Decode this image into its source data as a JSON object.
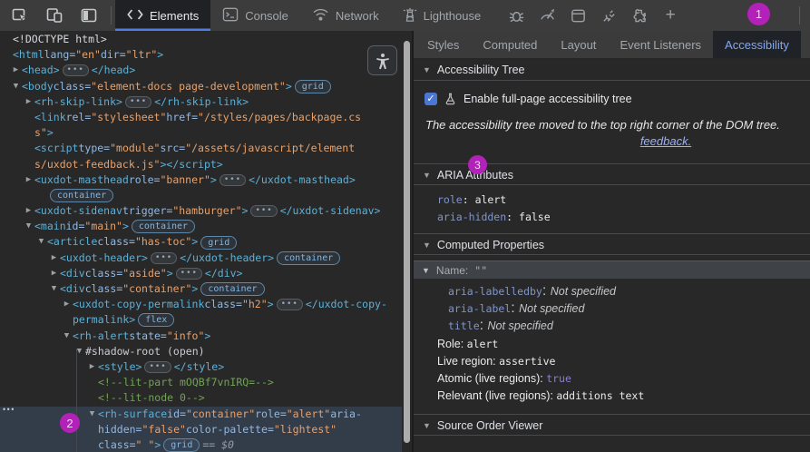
{
  "colors": {
    "accent_blue": "#4E7DE8",
    "badge_magenta": "#B322B8",
    "checkbox_blue": "#4A77D4",
    "link_blue": "#9BB0F5",
    "selection_bg": "#333C49"
  },
  "toolbar": {
    "left_icons": [
      "inspect-icon",
      "device-toolbar-icon",
      "dock-panel-icon"
    ],
    "tabs": [
      {
        "label": "Elements",
        "icon": "code-icon",
        "active": true
      },
      {
        "label": "Console",
        "icon": "console-icon",
        "active": false
      },
      {
        "label": "Network",
        "icon": "network-icon",
        "active": false
      },
      {
        "label": "Lighthouse",
        "icon": "lighthouse-icon",
        "active": false
      }
    ],
    "icon_tabs": [
      "bug-icon",
      "performance-gauge-icon",
      "application-box-icon",
      "plug-icon",
      "extension-puzzle-icon"
    ],
    "more_tabs_label": "+"
  },
  "annotations": {
    "step1": "1",
    "step2": "2",
    "step3": "3"
  },
  "dom_tree": {
    "gutter_dots": "•••",
    "accessibility_toggle_icon": "accessibility-person-icon",
    "rows": [
      {
        "d": 0,
        "seg": [
          [
            "p",
            "<!DOCTYPE html>"
          ]
        ]
      },
      {
        "d": 0,
        "seg": [
          [
            "t",
            "<html "
          ],
          [
            "a",
            "lang="
          ],
          [
            "v",
            "\"en\""
          ],
          [
            "a",
            " dir="
          ],
          [
            "v",
            "\"ltr\""
          ],
          [
            "t",
            ">"
          ]
        ]
      },
      {
        "d": 1,
        "a": "r",
        "seg": [
          [
            "t",
            "<head>"
          ],
          [
            "e",
            "…"
          ],
          [
            "t",
            "</head>"
          ]
        ]
      },
      {
        "d": 1,
        "a": "d",
        "seg": [
          [
            "t",
            "<body "
          ],
          [
            "a",
            "class="
          ],
          [
            "v",
            "\"element-docs page-development\""
          ],
          [
            "t",
            ">"
          ],
          [
            "b",
            "grid"
          ]
        ]
      },
      {
        "d": 2,
        "a": "r",
        "seg": [
          [
            "t",
            "<rh-skip-link>"
          ],
          [
            "e",
            "…"
          ],
          [
            "t",
            "</rh-skip-link>"
          ]
        ]
      },
      {
        "d": 2,
        "seg": [
          [
            "t",
            "<link "
          ],
          [
            "a",
            "rel="
          ],
          [
            "v",
            "\"stylesheet\""
          ],
          [
            "a",
            " href="
          ],
          [
            "v",
            "\"/styles/pages/backpage.cs"
          ]
        ]
      },
      {
        "d": 2,
        "seg": [
          [
            "v",
            "s\""
          ],
          [
            "t",
            ">"
          ]
        ]
      },
      {
        "d": 2,
        "seg": [
          [
            "t",
            "<script "
          ],
          [
            "a",
            "type="
          ],
          [
            "v",
            "\"module\""
          ],
          [
            "a",
            " src="
          ],
          [
            "v",
            "\"/assets/javascript/element"
          ]
        ]
      },
      {
        "d": 2,
        "seg": [
          [
            "v",
            "s/uxdot-feedback.js\""
          ],
          [
            "t",
            "></script>"
          ]
        ]
      },
      {
        "d": 2,
        "a": "r",
        "seg": [
          [
            "t",
            "<uxdot-masthead "
          ],
          [
            "a",
            "role="
          ],
          [
            "v",
            "\"banner\""
          ],
          [
            "t",
            ">"
          ],
          [
            "e",
            "…"
          ],
          [
            "t",
            "</uxdot-masthead>"
          ]
        ]
      },
      {
        "d": 3,
        "seg": [
          [
            "b",
            "container"
          ]
        ]
      },
      {
        "d": 2,
        "a": "r",
        "seg": [
          [
            "t",
            "<uxdot-sidenav "
          ],
          [
            "a",
            "trigger="
          ],
          [
            "v",
            "\"hamburger\""
          ],
          [
            "t",
            ">"
          ],
          [
            "e",
            "…"
          ],
          [
            "t",
            "</uxdot-sidenav>"
          ]
        ]
      },
      {
        "d": 2,
        "a": "d",
        "seg": [
          [
            "t",
            "<main "
          ],
          [
            "a",
            "id="
          ],
          [
            "v",
            "\"main\""
          ],
          [
            "t",
            ">"
          ],
          [
            "b",
            "container"
          ]
        ]
      },
      {
        "d": 3,
        "a": "d",
        "seg": [
          [
            "t",
            "<article "
          ],
          [
            "a",
            "class="
          ],
          [
            "v",
            "\"has-toc\""
          ],
          [
            "t",
            ">"
          ],
          [
            "b",
            "grid"
          ]
        ]
      },
      {
        "d": 4,
        "a": "r",
        "seg": [
          [
            "t",
            "<uxdot-header>"
          ],
          [
            "e",
            "…"
          ],
          [
            "t",
            "</uxdot-header>"
          ],
          [
            "b",
            "container"
          ]
        ]
      },
      {
        "d": 4,
        "a": "r",
        "seg": [
          [
            "t",
            "<div "
          ],
          [
            "a",
            "class="
          ],
          [
            "v",
            "\"aside\""
          ],
          [
            "t",
            ">"
          ],
          [
            "e",
            "…"
          ],
          [
            "t",
            "</div>"
          ]
        ]
      },
      {
        "d": 4,
        "a": "d",
        "seg": [
          [
            "t",
            "<div "
          ],
          [
            "a",
            "class="
          ],
          [
            "v",
            "\"container\""
          ],
          [
            "t",
            ">"
          ],
          [
            "b",
            "container"
          ]
        ]
      },
      {
        "d": 5,
        "a": "r",
        "seg": [
          [
            "t",
            "<uxdot-copy-permalink "
          ],
          [
            "a",
            "class="
          ],
          [
            "v",
            "\"h2\""
          ],
          [
            "t",
            ">"
          ],
          [
            "e",
            "…"
          ],
          [
            "t",
            "</uxdot-copy-"
          ]
        ]
      },
      {
        "d": 5,
        "seg": [
          [
            "t",
            "permalink>"
          ],
          [
            "b",
            "flex"
          ]
        ]
      },
      {
        "d": 5,
        "a": "d",
        "seg": [
          [
            "t",
            "<rh-alert "
          ],
          [
            "a",
            "state="
          ],
          [
            "v",
            "\"info\""
          ],
          [
            "t",
            ">"
          ]
        ]
      },
      {
        "d": 6,
        "a": "d",
        "seg": [
          [
            "s",
            "#shadow-root (open)"
          ]
        ]
      },
      {
        "d": 7,
        "a": "r",
        "seg": [
          [
            "t",
            "<style>"
          ],
          [
            "e",
            "…"
          ],
          [
            "t",
            "</style>"
          ]
        ]
      },
      {
        "d": 7,
        "seg": [
          [
            "c",
            "<!--lit-part mOQBf7vnIRQ=-->"
          ]
        ]
      },
      {
        "d": 7,
        "seg": [
          [
            "c",
            "<!--lit-node 0-->"
          ]
        ]
      },
      {
        "d": 7,
        "a": "d",
        "sel": true,
        "seg": [
          [
            "t",
            "<rh-surface "
          ],
          [
            "a",
            "id="
          ],
          [
            "v",
            "\"container\""
          ],
          [
            "a",
            " role="
          ],
          [
            "v",
            "\"alert\""
          ],
          [
            "a",
            " aria-"
          ]
        ]
      },
      {
        "d": 7,
        "sel": true,
        "seg": [
          [
            "a",
            "hidden="
          ],
          [
            "v",
            "\"false\""
          ],
          [
            "a",
            " color-palette="
          ],
          [
            "v",
            "\"lightest\""
          ]
        ]
      },
      {
        "d": 7,
        "sel": true,
        "seg": [
          [
            "a",
            "class="
          ],
          [
            "v",
            "\"  \""
          ],
          [
            "t",
            ">"
          ],
          [
            "b",
            "grid"
          ],
          [
            "d",
            " == $0"
          ]
        ]
      }
    ]
  },
  "sidebar": {
    "tabs": [
      {
        "label": "Styles",
        "active": false
      },
      {
        "label": "Computed",
        "active": false
      },
      {
        "label": "Layout",
        "active": false
      },
      {
        "label": "Event Listeners",
        "active": false
      },
      {
        "label": "Accessibility",
        "active": true
      }
    ],
    "accessibility_tree": {
      "title": "Accessibility Tree",
      "checkbox_checked": true,
      "checkbox_icon": "experiment-flask-icon",
      "checkbox_label": "Enable full-page accessibility tree",
      "notice_text": "The accessibility tree moved to the top right corner of the DOM tree.",
      "notice_link": "feedback."
    },
    "aria_attributes": {
      "title": "ARIA Attributes",
      "rows": [
        {
          "name": "role",
          "value": "alert"
        },
        {
          "name": "aria-hidden",
          "value": "false"
        }
      ]
    },
    "computed_properties": {
      "title": "Computed Properties",
      "name_row": {
        "label": "Name:",
        "value": "\"\""
      },
      "name_sources": [
        {
          "name": "aria-labelledby",
          "value": "Not specified"
        },
        {
          "name": "aria-label",
          "value": "Not specified"
        },
        {
          "name": "title",
          "value": "Not specified"
        }
      ],
      "props": [
        {
          "label": "Role:",
          "value": "alert",
          "style": "plain"
        },
        {
          "label": "Live region:",
          "value": "assertive",
          "style": "plain"
        },
        {
          "label": "Atomic (live regions):",
          "value": "true",
          "style": "purple"
        },
        {
          "label": "Relevant (live regions):",
          "value": "additions text",
          "style": "plain"
        }
      ]
    },
    "source_order": {
      "title": "Source Order Viewer"
    }
  }
}
